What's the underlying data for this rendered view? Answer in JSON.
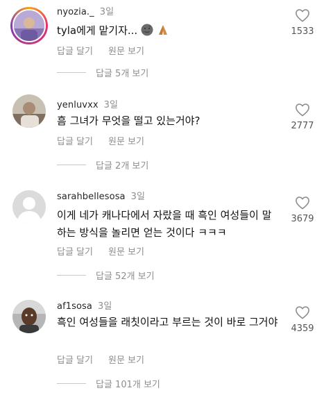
{
  "comments": [
    {
      "username": "nyozia._",
      "time": "3일",
      "text": "tyla에게 맡기자...",
      "emojis": [
        "new-moon-face-emoji",
        "folded-hands-emoji"
      ],
      "reply_label": "답글 달기",
      "translate_label": "원문 보기",
      "likes": "1533",
      "view_replies": "답글 5개 보기"
    },
    {
      "username": "yenluvxx",
      "time": "3일",
      "text": "흠 그녀가 무엇을 떨고 있는거야?",
      "reply_label": "답글 달기",
      "translate_label": "원문 보기",
      "likes": "2777",
      "view_replies": "답글 2개 보기"
    },
    {
      "username": "sarahbellesosa",
      "time": "3일",
      "text": "이게 네가 캐나다에서 자랐을 때 흑인 여성들이 말하는 방식을 놀리면 얻는 것이다 ㅋㅋㅋ",
      "reply_label": "답글 달기",
      "translate_label": "원문 보기",
      "likes": "3679",
      "view_replies": "답글 52개 보기"
    },
    {
      "username": "af1sosa",
      "time": "3일",
      "text": "흑인 여성들을 래칫이라고 부르는 것이 바로 그거야",
      "reply_label": "답글 달기",
      "translate_label": "원문 보기",
      "likes": "4359",
      "view_replies": "답글 101개 보기"
    }
  ]
}
